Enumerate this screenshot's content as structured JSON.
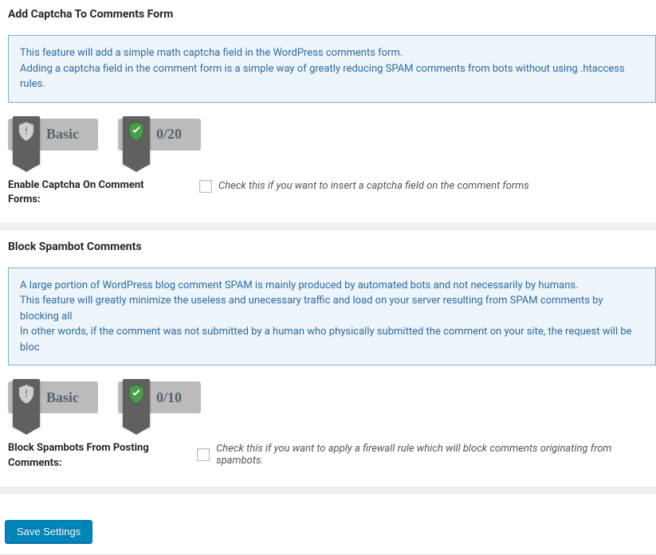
{
  "section1": {
    "title": "Add Captcha To Comments Form",
    "info_line1": "This feature will add a simple math captcha field in the WordPress comments form.",
    "info_line2": "Adding a captcha field in the comment form is a simple way of greatly reducing SPAM comments from bots without using .htaccess rules.",
    "badge_basic": "Basic",
    "badge_score": "0/20",
    "setting_label": "Enable Captcha On Comment Forms:",
    "setting_desc": "Check this if you want to insert a captcha field on the comment forms"
  },
  "section2": {
    "title": "Block Spambot Comments",
    "info_line1": "A large portion of WordPress blog comment SPAM is mainly produced by automated bots and not necessarily by humans.",
    "info_line2": "This feature will greatly minimize the useless and unecessary traffic and load on your server resulting from SPAM comments by blocking all",
    "info_line3": "In other words, if the comment was not submitted by a human who physically submitted the comment on your site, the request will be bloc",
    "badge_basic": "Basic",
    "badge_score": "0/10",
    "setting_label": "Block Spambots From Posting Comments:",
    "setting_desc": "Check this if you want to apply a firewall rule which will block comments originating from spambots."
  },
  "save_button": "Save Settings"
}
